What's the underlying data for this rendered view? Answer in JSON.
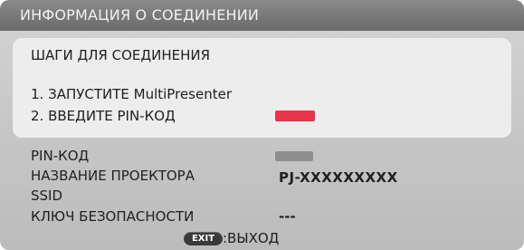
{
  "window": {
    "title": "ИНФОРМАЦИЯ О СОЕДИНЕНИИ"
  },
  "steps_box": {
    "heading": "ШАГИ ДЛЯ СОЕДИНЕНИЯ",
    "step1": "1. ЗАПУСТИТЕ MultiPresenter",
    "step2": "2. ВВЕДИТЕ PIN-КОД",
    "pin_highlight_color": "#e8334a"
  },
  "info": {
    "pin_label": "PIN-КОД",
    "pin_mask_color": "#8e8e8e",
    "projector_name_label": "НАЗВАНИЕ ПРОЕКТОРА",
    "projector_name_value": "PJ-XXXXXXXXX",
    "ssid_label": "SSID",
    "ssid_value": "",
    "security_key_label": "КЛЮЧ БЕЗОПАСНОСТИ",
    "security_key_value": "---"
  },
  "footer": {
    "exit_key": "EXIT",
    "exit_label": ":ВЫХОД"
  }
}
